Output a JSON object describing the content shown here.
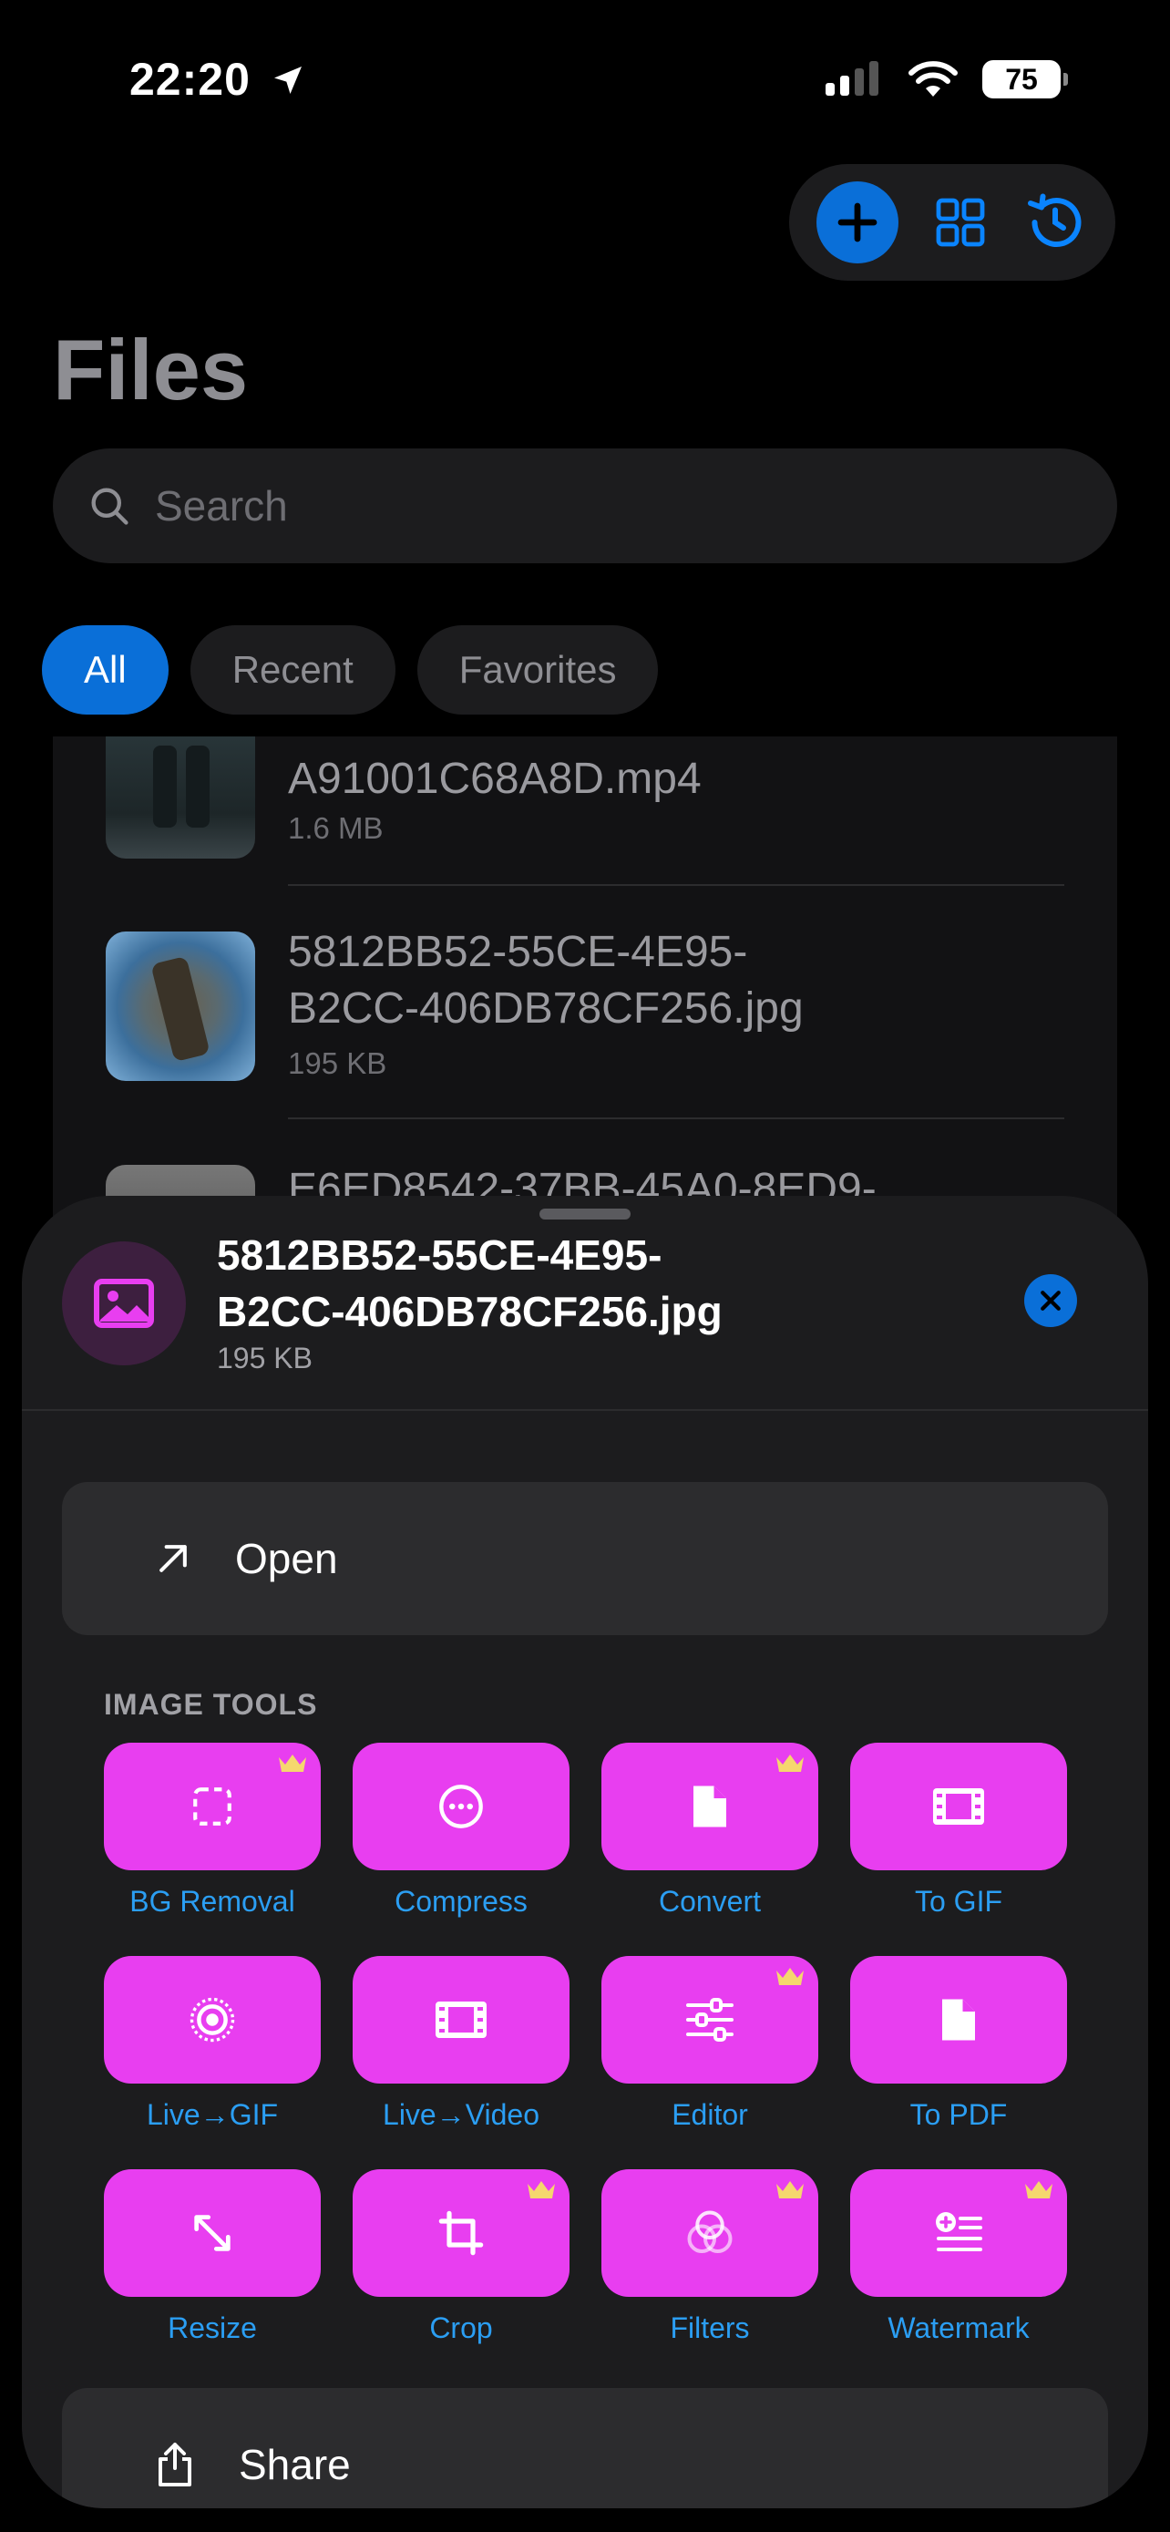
{
  "status_bar": {
    "time": "22:20",
    "battery": "75"
  },
  "header": {
    "title": "Files"
  },
  "search": {
    "placeholder": "Search"
  },
  "filters": [
    {
      "label": "All",
      "active": true
    },
    {
      "label": "Recent",
      "active": false
    },
    {
      "label": "Favorites",
      "active": false
    }
  ],
  "files": [
    {
      "name": "A91001C68A8D.mp4",
      "size": "1.6 MB"
    },
    {
      "name_line1": "5812BB52-55CE-4E95-",
      "name_line2": "B2CC-406DB78CF256.jpg",
      "size": "195 KB"
    },
    {
      "name": "E6ED8542-37BB-45A0-8ED9-"
    }
  ],
  "sheet": {
    "file_name_line1": "5812BB52-55CE-4E95-",
    "file_name_line2": "B2CC-406DB78CF256.jpg",
    "file_size": "195 KB",
    "open_label": "Open",
    "section_title": "IMAGE TOOLS",
    "tools": [
      {
        "label": "BG Removal",
        "icon": "dashed-square-icon",
        "premium": true
      },
      {
        "label": "Compress",
        "icon": "ellipsis-circle-icon",
        "premium": false
      },
      {
        "label": "Convert",
        "icon": "document-icon",
        "premium": true
      },
      {
        "label": "To GIF",
        "icon": "film-icon",
        "premium": false
      },
      {
        "label": "Live→GIF",
        "icon": "live-photo-icon",
        "premium": false
      },
      {
        "label": "Live→Video",
        "icon": "film-icon",
        "premium": false
      },
      {
        "label": "Editor",
        "icon": "sliders-icon",
        "premium": true
      },
      {
        "label": "To PDF",
        "icon": "document-icon",
        "premium": false
      },
      {
        "label": "Resize",
        "icon": "resize-arrows-icon",
        "premium": false
      },
      {
        "label": "Crop",
        "icon": "crop-icon",
        "premium": true
      },
      {
        "label": "Filters",
        "icon": "overlapping-circles-icon",
        "premium": true
      },
      {
        "label": "Watermark",
        "icon": "text-add-icon",
        "premium": true
      }
    ],
    "share_label": "Share"
  },
  "colors": {
    "accent": "#0a6fd8",
    "tool_bg": "#e83ef0",
    "tool_label": "#2b9ef3",
    "crown": "#f5d76e"
  }
}
